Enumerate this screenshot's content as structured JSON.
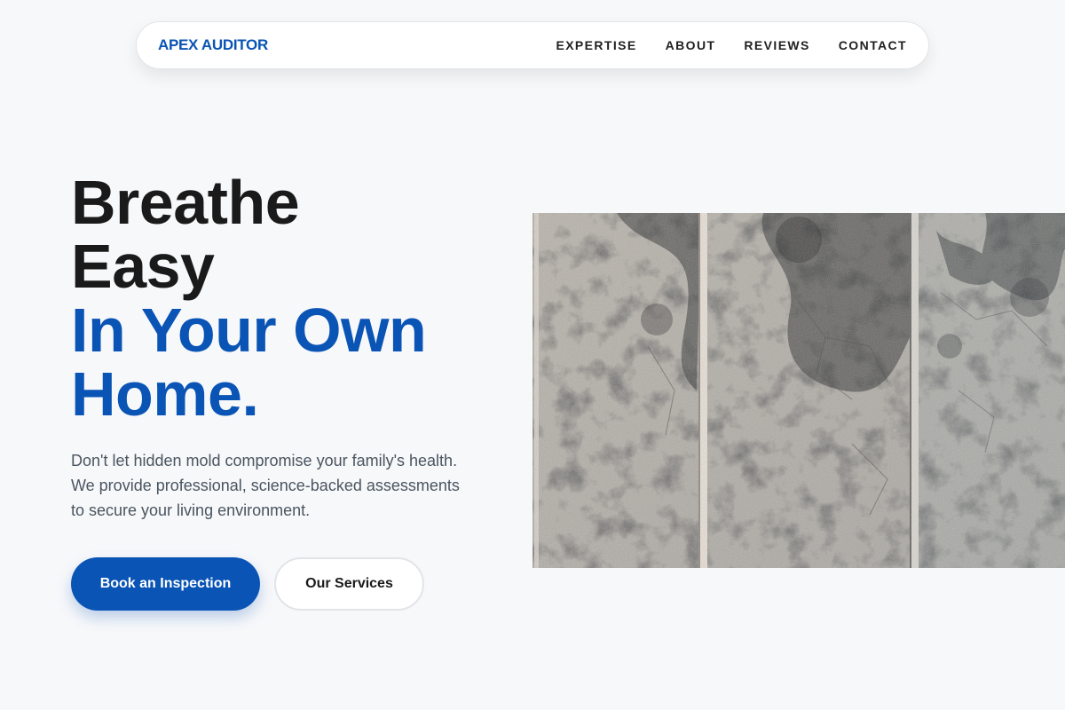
{
  "nav": {
    "brand": "APEX AUDITOR",
    "links": [
      "EXPERTISE",
      "ABOUT",
      "REVIEWS",
      "CONTACT"
    ]
  },
  "hero": {
    "title_line1": "Breathe",
    "title_line2": "Easy",
    "title_line3": "In Your Own",
    "title_line4": "Home.",
    "description": "Don't let hidden mold compromise your family's health. We provide professional, science-backed assessments to secure your living environment.",
    "primary_button": "Book an Inspection",
    "secondary_button": "Our Services"
  },
  "image": {
    "subject": "mold-stained concrete wall panels"
  },
  "colors": {
    "brand_blue": "#0a54b5",
    "background": "#f7f8fa",
    "heading_dark": "#1a1a1a",
    "body_text": "#4a5560"
  }
}
